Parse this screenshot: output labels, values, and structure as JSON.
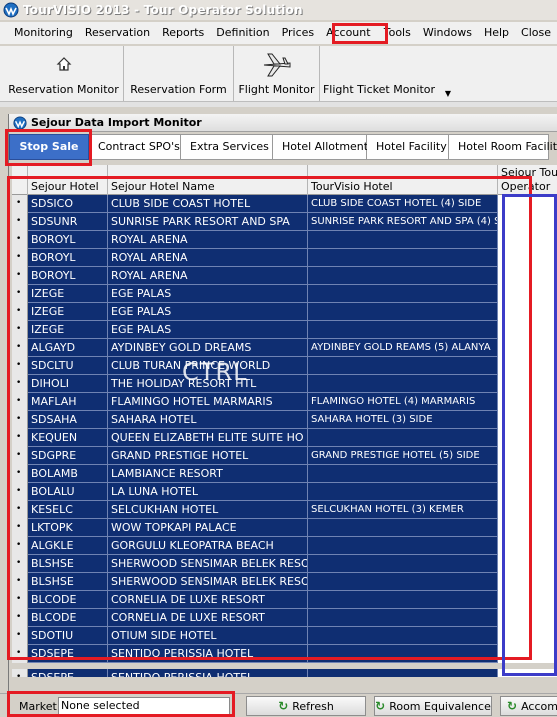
{
  "window": {
    "title": "TourVISIO 2013 - Tour Operator Solution"
  },
  "menu": [
    "Monitoring",
    "Reservation",
    "Reports",
    "Definition",
    "Prices",
    "Accounting",
    "Tools",
    "Windows",
    "Help",
    "Close"
  ],
  "toolbar": {
    "reservation_monitor": "Reservation Monitor",
    "reservation_form": "Reservation Form",
    "flight_monitor": "Flight Monitor",
    "flight_ticket_monitor": "Flight Ticket Monitor"
  },
  "child": {
    "title": "Sejour Data Import Monitor"
  },
  "tabs": [
    "Stop Sale",
    "Contract SPO's",
    "Extra Services",
    "Hotel Allotment",
    "Hotel Facility",
    "Hotel Room Facility"
  ],
  "grid": {
    "headers": {
      "code": "Sejour Hotel",
      "name": "Sejour Hotel Name",
      "tourvisio": "TourVisio Hotel",
      "operator_1": "Sejour Tour",
      "operator_2": "Operator"
    },
    "rows": [
      {
        "code": "SDSICO",
        "name": "CLUB SIDE COAST HOTEL",
        "tv": "CLUB SIDE COAST HOTEL (4) SIDE"
      },
      {
        "code": "SDSUNR",
        "name": "SUNRISE PARK RESORT AND SPA",
        "tv": "SUNRISE PARK RESORT AND SPA (4) S"
      },
      {
        "code": "BOROYL",
        "name": "ROYAL ARENA",
        "tv": ""
      },
      {
        "code": "BOROYL",
        "name": "ROYAL ARENA",
        "tv": ""
      },
      {
        "code": "BOROYL",
        "name": "ROYAL ARENA",
        "tv": ""
      },
      {
        "code": "IZEGE",
        "name": "EGE PALAS",
        "tv": ""
      },
      {
        "code": "IZEGE",
        "name": "EGE PALAS",
        "tv": ""
      },
      {
        "code": "IZEGE",
        "name": "EGE PALAS",
        "tv": ""
      },
      {
        "code": "ALGAYD",
        "name": "AYDINBEY GOLD DREAMS",
        "tv": "AYDINBEY GOLD REAMS (5) ALANYA"
      },
      {
        "code": "SDCLTU",
        "name": "CLUB TURAN PRINCE WORLD",
        "tv": ""
      },
      {
        "code": "DIHOLI",
        "name": "THE HOLIDAY RESORT HTL",
        "tv": ""
      },
      {
        "code": "MAFLAH",
        "name": "FLAMINGO HOTEL MARMARIS",
        "tv": "FLAMINGO HOTEL (4) MARMARIS"
      },
      {
        "code": "SDSAHA",
        "name": "SAHARA HOTEL",
        "tv": "SAHARA HOTEL (3) SIDE"
      },
      {
        "code": "KEQUEN",
        "name": "QUEEN ELIZABETH ELITE SUITE HO",
        "tv": ""
      },
      {
        "code": "SDGPRE",
        "name": "GRAND PRESTIGE HOTEL",
        "tv": "GRAND PRESTIGE HOTEL (5) SIDE"
      },
      {
        "code": "BOLAMB",
        "name": "LAMBIANCE RESORT",
        "tv": ""
      },
      {
        "code": "BOLALU",
        "name": "LA LUNA HOTEL",
        "tv": ""
      },
      {
        "code": "KESELC",
        "name": "SELCUKHAN HOTEL",
        "tv": "SELCUKHAN HOTEL (3) KEMER"
      },
      {
        "code": "LKTOPK",
        "name": "WOW TOPKAPI PALACE",
        "tv": ""
      },
      {
        "code": "ALGKLE",
        "name": "GORGULU KLEOPATRA BEACH",
        "tv": ""
      },
      {
        "code": "BLSHSE",
        "name": "SHERWOOD SENSIMAR BELEK RESOI",
        "tv": ""
      },
      {
        "code": "BLSHSE",
        "name": "SHERWOOD SENSIMAR BELEK RESOI",
        "tv": ""
      },
      {
        "code": "BLCODE",
        "name": "CORNELIA DE LUXE RESORT",
        "tv": ""
      },
      {
        "code": "BLCODE",
        "name": "CORNELIA DE LUXE RESORT",
        "tv": ""
      },
      {
        "code": "SDOTIU",
        "name": "OTIUM SIDE HOTEL",
        "tv": ""
      },
      {
        "code": "SDSEPE",
        "name": "SENTIDO PERISSIA HOTEL",
        "tv": ""
      }
    ],
    "last_row": {
      "code": "SDSEPE",
      "name": "SENTIDO PERISSIA HOTEL",
      "tv": ""
    }
  },
  "overlay_text": "CTRL",
  "status": {
    "market_label": "Market",
    "market_value": "None selected",
    "refresh": "Refresh",
    "room_equivalence": "Room Equivalence",
    "accom": "Accom"
  },
  "colors": {
    "grid_bg": "#0f2e72",
    "active_tab": "#3c6fc8",
    "highlight_red": "#e41b23",
    "highlight_blue": "#3c3cc8"
  }
}
